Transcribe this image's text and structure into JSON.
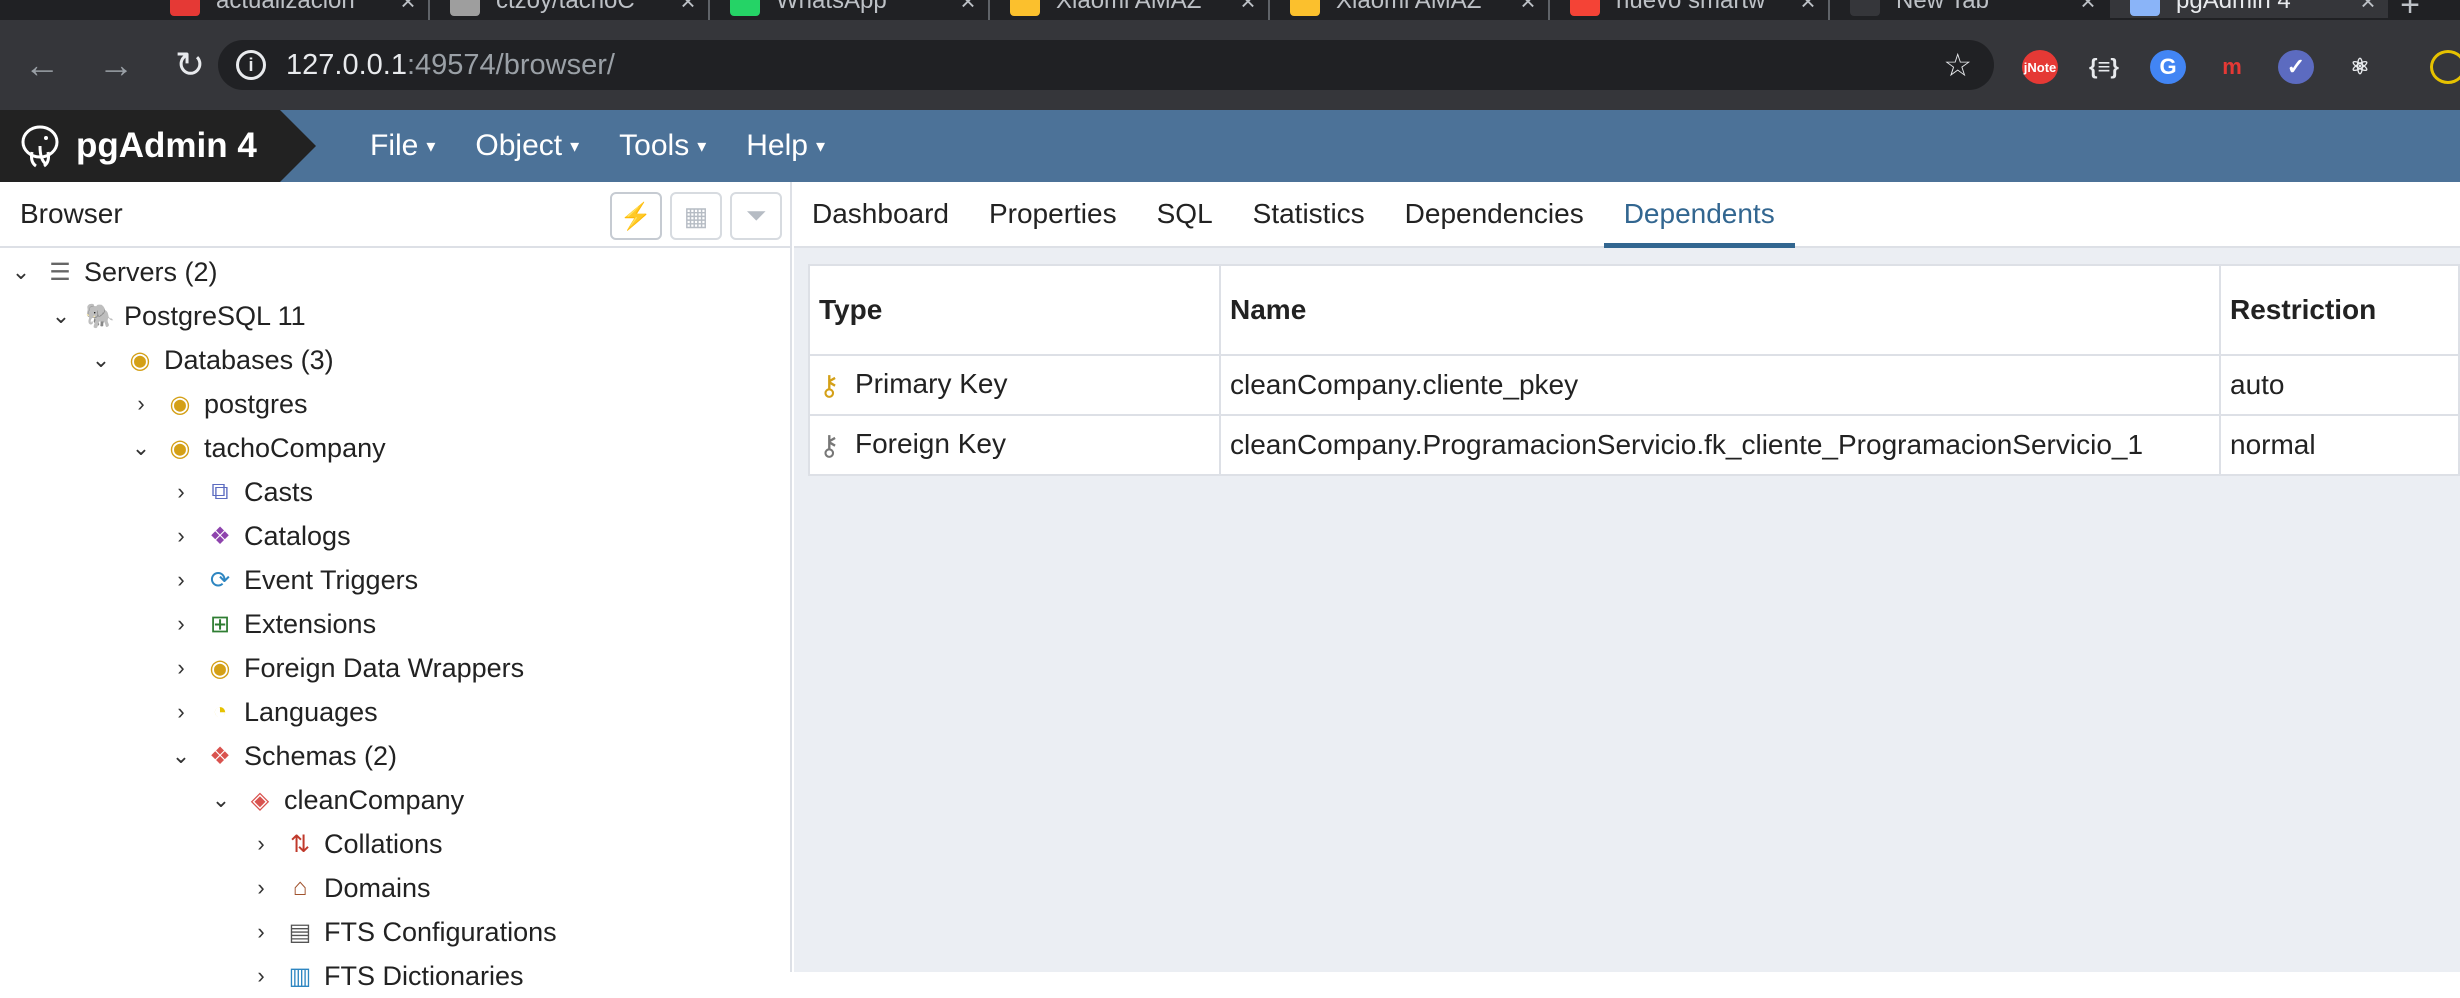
{
  "browser": {
    "tabs": [
      {
        "title": "actualizacion",
        "favicon_color": "#e53935"
      },
      {
        "title": "ctzoy/tachoC",
        "favicon_color": "#9e9e9e"
      },
      {
        "title": "WhatsApp",
        "favicon_color": "#25d366"
      },
      {
        "title": "Xiaomi AMAZ",
        "favicon_color": "#fbc02d"
      },
      {
        "title": "Xiaomi AMAZ",
        "favicon_color": "#fbc02d"
      },
      {
        "title": "nuevo smartw",
        "favicon_color": "#f44336"
      },
      {
        "title": "New Tab",
        "favicon_color": "#35363a"
      },
      {
        "title": "pgAdmin 4",
        "favicon_color": "#8ab4f8"
      }
    ],
    "url_host": "127.0.0.1",
    "url_rest": ":49574/browser/",
    "extensions": [
      {
        "label": "jNote",
        "color": "#ffffff",
        "bg": "#e53935"
      },
      {
        "label": "{≡}",
        "color": "#e8eaed",
        "bg": "transparent"
      },
      {
        "label": "G",
        "color": "#ffffff",
        "bg": "#4285f4"
      },
      {
        "label": "m",
        "color": "#e53935",
        "bg": "transparent"
      },
      {
        "label": "✓",
        "color": "#ffffff",
        "bg": "#5c6bc0"
      },
      {
        "label": "⚛",
        "color": "#e8eaed",
        "bg": "transparent"
      }
    ]
  },
  "app": {
    "brand": "pgAdmin 4",
    "menu": [
      "File",
      "Object",
      "Tools",
      "Help"
    ]
  },
  "browser_panel": {
    "title": "Browser",
    "tree": [
      {
        "label": "Servers (2)",
        "level": 0,
        "chevron": "⌄",
        "icon": "servers-icon",
        "glyph": "☰",
        "color": "#666"
      },
      {
        "label": "PostgreSQL 11",
        "level": 1,
        "chevron": "⌄",
        "icon": "postgresql-server-icon",
        "glyph": "🐘",
        "color": "#336791"
      },
      {
        "label": "Databases (3)",
        "level": 2,
        "chevron": "⌄",
        "icon": "databases-icon",
        "glyph": "◉",
        "color": "#d4a017"
      },
      {
        "label": "postgres",
        "level": 3,
        "chevron": "›",
        "icon": "database-icon",
        "glyph": "◉",
        "color": "#d4a017"
      },
      {
        "label": "tachoCompany",
        "level": 3,
        "chevron": "⌄",
        "icon": "database-icon",
        "glyph": "◉",
        "color": "#d4a017"
      },
      {
        "label": "Casts",
        "level": 4,
        "chevron": "›",
        "icon": "casts-icon",
        "glyph": "⧉",
        "color": "#5c6bc0"
      },
      {
        "label": "Catalogs",
        "level": 4,
        "chevron": "›",
        "icon": "catalogs-icon",
        "glyph": "❖",
        "color": "#8e44ad"
      },
      {
        "label": "Event Triggers",
        "level": 4,
        "chevron": "›",
        "icon": "event-triggers-icon",
        "glyph": "⟳",
        "color": "#2e86c1"
      },
      {
        "label": "Extensions",
        "level": 4,
        "chevron": "›",
        "icon": "extensions-icon",
        "glyph": "⊞",
        "color": "#2e7d32"
      },
      {
        "label": "Foreign Data Wrappers",
        "level": 4,
        "chevron": "›",
        "icon": "foreign-data-wrappers-icon",
        "glyph": "◉",
        "color": "#d4a017"
      },
      {
        "label": "Languages",
        "level": 4,
        "chevron": "›",
        "icon": "languages-icon",
        "glyph": "◔",
        "color": "#e6c200"
      },
      {
        "label": "Schemas (2)",
        "level": 4,
        "chevron": "⌄",
        "icon": "schemas-icon",
        "glyph": "❖",
        "color": "#d9534f"
      },
      {
        "label": "cleanCompany",
        "level": 5,
        "chevron": "⌄",
        "icon": "schema-icon",
        "glyph": "◈",
        "color": "#d9534f"
      },
      {
        "label": "Collations",
        "level": 6,
        "chevron": "›",
        "icon": "collations-icon",
        "glyph": "⇅",
        "color": "#c0392b"
      },
      {
        "label": "Domains",
        "level": 6,
        "chevron": "›",
        "icon": "domains-icon",
        "glyph": "⌂",
        "color": "#a0522d"
      },
      {
        "label": "FTS Configurations",
        "level": 6,
        "chevron": "›",
        "icon": "fts-configurations-icon",
        "glyph": "▤",
        "color": "#555"
      },
      {
        "label": "FTS Dictionaries",
        "level": 6,
        "chevron": "›",
        "icon": "fts-dictionaries-icon",
        "glyph": "▥",
        "color": "#2e86c1"
      }
    ]
  },
  "content_panel": {
    "tabs": [
      "Dashboard",
      "Properties",
      "SQL",
      "Statistics",
      "Dependencies",
      "Dependents"
    ],
    "active_tab": "Dependents",
    "columns": [
      "Type",
      "Name",
      "Restriction"
    ],
    "rows": [
      {
        "type": "Primary Key",
        "icon": "primary-key-icon",
        "icon_color": "#d4a017",
        "name": "cleanCompany.cliente_pkey",
        "restriction": "auto"
      },
      {
        "type": "Foreign Key",
        "icon": "foreign-key-icon",
        "icon_color": "#777777",
        "name": "cleanCompany.ProgramacionServicio.fk_cliente_ProgramacionServicio_1",
        "restriction": "normal"
      }
    ]
  }
}
